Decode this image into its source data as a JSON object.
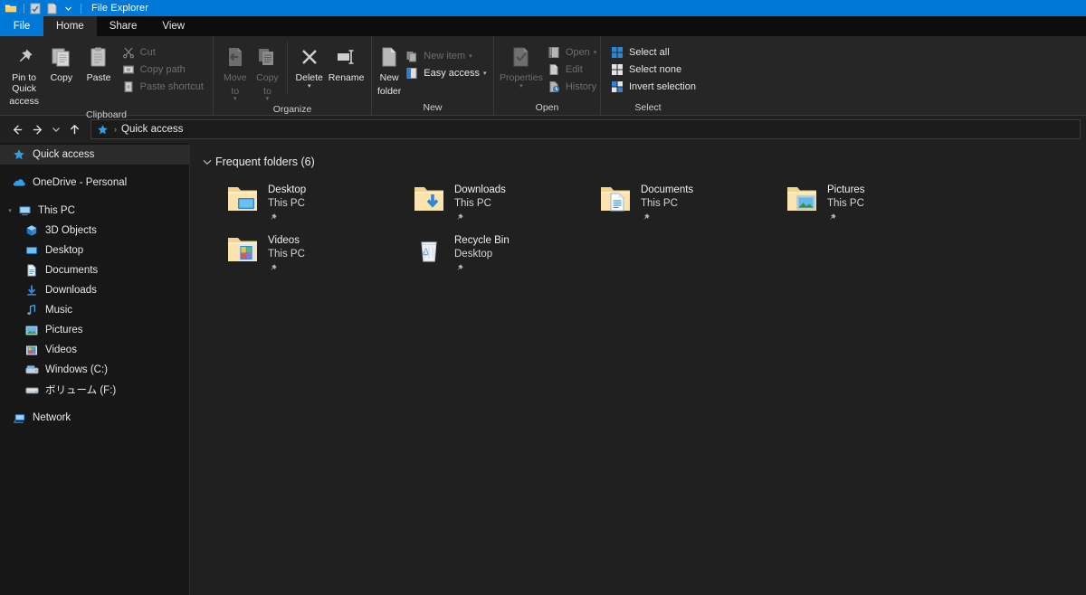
{
  "titlebar": {
    "title": "File Explorer",
    "icons": [
      "folder-icon",
      "properties-icon",
      "new-folder-icon",
      "customize-quick-access-chevron-icon"
    ]
  },
  "tabs": [
    {
      "label": "File",
      "name": "tab-file",
      "state": "file"
    },
    {
      "label": "Home",
      "name": "tab-home",
      "state": "active"
    },
    {
      "label": "Share",
      "name": "tab-share",
      "state": "normal"
    },
    {
      "label": "View",
      "name": "tab-view",
      "state": "normal"
    }
  ],
  "ribbon": {
    "groups": [
      {
        "label": "Clipboard",
        "big": [
          {
            "label": "Pin to Quick\naccess",
            "line1": "Pin to Quick",
            "line2": "access",
            "icon": "pin-icon",
            "disabled": false
          },
          {
            "label": "Copy",
            "line1": "Copy",
            "line2": "",
            "icon": "copy-icon",
            "disabled": false
          },
          {
            "label": "Paste",
            "line1": "Paste",
            "line2": "",
            "icon": "paste-icon",
            "disabled": false
          }
        ],
        "small": [
          {
            "label": "Cut",
            "icon": "scissors-icon",
            "disabled": true,
            "caret": false
          },
          {
            "label": "Copy path",
            "icon": "copy-path-icon",
            "disabled": true,
            "caret": false
          },
          {
            "label": "Paste shortcut",
            "icon": "paste-shortcut-icon",
            "disabled": true,
            "caret": false
          }
        ]
      },
      {
        "label": "Organize",
        "big": [
          {
            "line1": "Move",
            "line2": "to",
            "icon": "move-to-icon",
            "disabled": true,
            "caret": true
          },
          {
            "line1": "Copy",
            "line2": "to",
            "icon": "copy-to-icon",
            "disabled": true,
            "caret": true
          },
          {
            "line1": "Delete",
            "line2": "",
            "icon": "delete-icon",
            "disabled": false,
            "caret": true
          },
          {
            "line1": "Rename",
            "line2": "",
            "icon": "rename-icon",
            "disabled": false,
            "caret": false
          }
        ],
        "small": []
      },
      {
        "label": "New",
        "big": [
          {
            "line1": "New",
            "line2": "folder",
            "icon": "new-folder-icon",
            "disabled": false,
            "caret": false
          }
        ],
        "small": [
          {
            "label": "New item",
            "icon": "new-item-icon",
            "disabled": true,
            "caret": true
          },
          {
            "label": "Easy access",
            "icon": "easy-access-icon",
            "disabled": false,
            "caret": true
          }
        ]
      },
      {
        "label": "Open",
        "big": [
          {
            "line1": "Properties",
            "line2": "",
            "icon": "properties-icon",
            "disabled": true,
            "caret": true
          }
        ],
        "small": [
          {
            "label": "Open",
            "icon": "open-icon",
            "disabled": true,
            "caret": true
          },
          {
            "label": "Edit",
            "icon": "edit-icon",
            "disabled": true,
            "caret": false
          },
          {
            "label": "History",
            "icon": "history-icon",
            "disabled": true,
            "caret": false
          }
        ]
      },
      {
        "label": "Select",
        "big": [],
        "small": [
          {
            "label": "Select all",
            "icon": "select-all-icon",
            "disabled": false,
            "caret": false
          },
          {
            "label": "Select none",
            "icon": "select-none-icon",
            "disabled": false,
            "caret": false
          },
          {
            "label": "Invert selection",
            "icon": "invert-selection-icon",
            "disabled": false,
            "caret": false
          }
        ]
      }
    ]
  },
  "navbar": {
    "back_icon": "back-arrow-icon",
    "forward_icon": "forward-arrow-icon",
    "recent_icon": "recent-locations-chevron-icon",
    "up_icon": "up-arrow-icon",
    "address": {
      "icon": "quick-access-star-icon",
      "separator": "›",
      "text": "Quick access"
    }
  },
  "sidebar": {
    "items": [
      {
        "label": "Quick access",
        "icon": "star-icon",
        "indent": 0,
        "selected": true,
        "expander": ""
      },
      {
        "label": "",
        "icon": "spacer",
        "indent": 0,
        "selected": false,
        "expander": ""
      },
      {
        "label": "OneDrive - Personal",
        "icon": "onedrive-icon",
        "indent": 0,
        "selected": false,
        "expander": ""
      },
      {
        "label": "",
        "icon": "spacer",
        "indent": 0,
        "selected": false,
        "expander": ""
      },
      {
        "label": "This PC",
        "icon": "this-pc-icon",
        "indent": 0,
        "selected": false,
        "expander": "▾"
      },
      {
        "label": "3D Objects",
        "icon": "3d-objects-icon",
        "indent": 1,
        "selected": false,
        "expander": ""
      },
      {
        "label": "Desktop",
        "icon": "desktop-icon",
        "indent": 1,
        "selected": false,
        "expander": ""
      },
      {
        "label": "Documents",
        "icon": "documents-icon",
        "indent": 1,
        "selected": false,
        "expander": ""
      },
      {
        "label": "Downloads",
        "icon": "downloads-icon",
        "indent": 1,
        "selected": false,
        "expander": ""
      },
      {
        "label": "Music",
        "icon": "music-icon",
        "indent": 1,
        "selected": false,
        "expander": ""
      },
      {
        "label": "Pictures",
        "icon": "pictures-icon",
        "indent": 1,
        "selected": false,
        "expander": ""
      },
      {
        "label": "Videos",
        "icon": "videos-icon",
        "indent": 1,
        "selected": false,
        "expander": ""
      },
      {
        "label": "Windows (C:)",
        "icon": "hard-drive-icon",
        "indent": 1,
        "selected": false,
        "expander": ""
      },
      {
        "label": "ボリューム (F:)",
        "icon": "drive-icon",
        "indent": 1,
        "selected": false,
        "expander": ""
      },
      {
        "label": "",
        "icon": "spacer",
        "indent": 0,
        "selected": false,
        "expander": ""
      },
      {
        "label": "Network",
        "icon": "network-icon",
        "indent": 0,
        "selected": false,
        "expander": ""
      }
    ]
  },
  "content": {
    "section_title": "Frequent folders (6)",
    "section_chevron": "⌄",
    "tiles": [
      {
        "name": "Desktop",
        "sub": "This PC",
        "icon": "folder-desktop-icon",
        "pinned": true
      },
      {
        "name": "Downloads",
        "sub": "This PC",
        "icon": "folder-downloads-icon",
        "pinned": true
      },
      {
        "name": "Documents",
        "sub": "This PC",
        "icon": "folder-documents-icon",
        "pinned": true
      },
      {
        "name": "Pictures",
        "sub": "This PC",
        "icon": "folder-pictures-icon",
        "pinned": true
      },
      {
        "name": "Videos",
        "sub": "This PC",
        "icon": "folder-videos-icon",
        "pinned": true
      },
      {
        "name": "Recycle Bin",
        "sub": "Desktop",
        "icon": "recycle-bin-icon",
        "pinned": true
      }
    ]
  },
  "colors": {
    "accent": "#0078d7",
    "titlebar": "#0078d7",
    "ribbon": "#262626",
    "sidebar": "#171717",
    "content": "#202020",
    "folder": "#f0d18a"
  }
}
